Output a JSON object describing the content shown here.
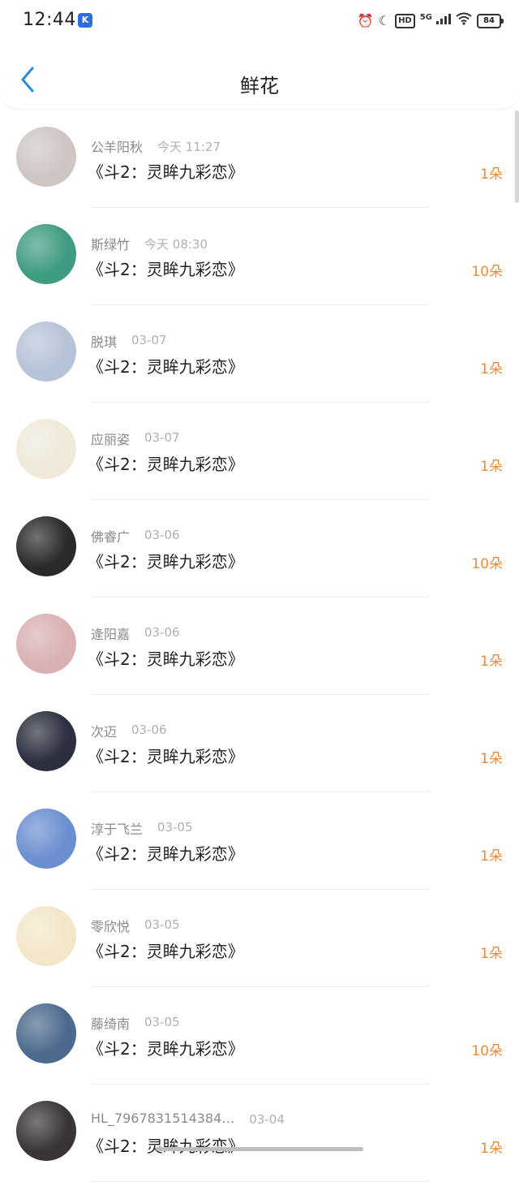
{
  "status_bar": {
    "time": "12:44",
    "app_badge": "K",
    "battery": "84",
    "network": "5G",
    "hd": "HD"
  },
  "header": {
    "title": "鲜花"
  },
  "items": [
    {
      "name": "公羊阳秋",
      "time": "今天 11:27",
      "book": "《斗2：灵眸九彩恋》",
      "count": "1朵",
      "avatar_color": "#cfc6c4"
    },
    {
      "name": "斯绿竹",
      "time": "今天 08:30",
      "book": "《斗2：灵眸九彩恋》",
      "count": "10朵",
      "avatar_color": "#3f9b83"
    },
    {
      "name": "脱琪",
      "time": "03-07",
      "book": "《斗2：灵眸九彩恋》",
      "count": "1朵",
      "avatar_color": "#b7c3d8"
    },
    {
      "name": "应丽姿",
      "time": "03-07",
      "book": "《斗2：灵眸九彩恋》",
      "count": "1朵",
      "avatar_color": "#efe9d9"
    },
    {
      "name": "佛睿广",
      "time": "03-06",
      "book": "《斗2：灵眸九彩恋》",
      "count": "10朵",
      "avatar_color": "#2a2a2a"
    },
    {
      "name": "逄阳嘉",
      "time": "03-06",
      "book": "《斗2：灵眸九彩恋》",
      "count": "1朵",
      "avatar_color": "#d9b1b3"
    },
    {
      "name": "次迈",
      "time": "03-06",
      "book": "《斗2：灵眸九彩恋》",
      "count": "1朵",
      "avatar_color": "#2b2f3e"
    },
    {
      "name": "淳于飞兰",
      "time": "03-05",
      "book": "《斗2：灵眸九彩恋》",
      "count": "1朵",
      "avatar_color": "#6b8fd1"
    },
    {
      "name": "零欣悦",
      "time": "03-05",
      "book": "《斗2：灵眸九彩恋》",
      "count": "1朵",
      "avatar_color": "#f3e7c9"
    },
    {
      "name": "藤绮南",
      "time": "03-05",
      "book": "《斗2：灵眸九彩恋》",
      "count": "10朵",
      "avatar_color": "#4c6a8e"
    },
    {
      "name": "HL_7967831514384…",
      "time": "03-04",
      "book": "《斗2：灵眸九彩恋》",
      "count": "1朵",
      "avatar_color": "#3a3436"
    }
  ]
}
